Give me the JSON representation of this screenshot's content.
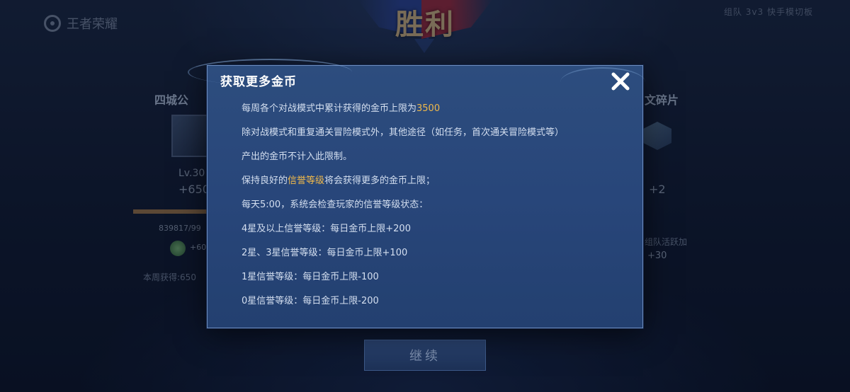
{
  "header": {
    "logo_text": "王者荣耀",
    "victory_text": "胜利",
    "mode_label": "组队 3v3 快手模切板"
  },
  "left_panel": {
    "title": "四城公",
    "level": "Lv.30",
    "exp_gain": "+650",
    "exp_numbers": "839817/99",
    "coin_value": "+60",
    "weekly_text": "本周获得:650"
  },
  "right_panel": {
    "title": "文碎片",
    "plus_value": "+2",
    "label": "组队活跃加",
    "value": "+30"
  },
  "modal": {
    "title": "获取更多金币",
    "lines": {
      "l1_a": "每周各个对战模式中累计获得的金币上限为",
      "l1_b": "3500",
      "l2": "除对战模式和重复通关冒险模式外，其他途径（如任务，首次通关冒险模式等）",
      "l3": "产出的金币不计入此限制。",
      "l4_a": "保持良好的",
      "l4_b": "信誉等级",
      "l4_c": "将会获得更多的金币上限；",
      "l5": "每天5:00，系统会检查玩家的信誉等级状态：",
      "l6": "4星及以上信誉等级：每日金币上限+200",
      "l7": "2星、3星信誉等级：每日金币上限+100",
      "l8": "1星信誉等级：每日金币上限-100",
      "l9": "0星信誉等级：每日金币上限-200"
    }
  },
  "footer": {
    "continue_label": "继续"
  },
  "colors": {
    "highlight": "#f0b94a",
    "modal_bg": "#2a4878",
    "modal_border": "#6d8dbf"
  }
}
